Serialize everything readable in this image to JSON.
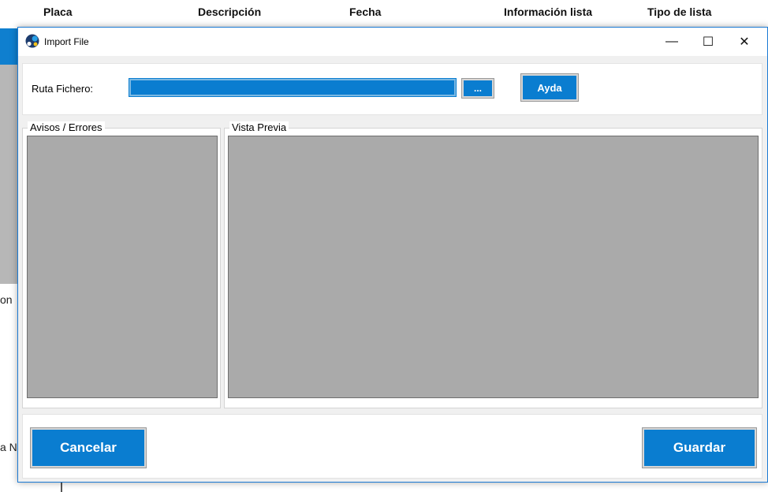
{
  "background": {
    "columns": [
      "Placa",
      "Descripción",
      "Fecha",
      "Información lista",
      "Tipo de lista"
    ],
    "fragment_1": "on",
    "fragment_2": "a N"
  },
  "dialog": {
    "title": "Import File",
    "controls": {
      "minimize": "—",
      "maximize": "☐",
      "close": "✕"
    },
    "ruta_label": "Ruta Fichero:",
    "ruta_value": "",
    "browse_label": "...",
    "help_label": "Ayda",
    "warnings_title": "Avisos / Errores",
    "preview_title": "Vista Previa",
    "cancel_label": "Cancelar",
    "save_label": "Guardar"
  },
  "colors": {
    "accent": "#0a7dd0",
    "content_gray": "#aaaaaa",
    "client_bg": "#f0f0f0"
  }
}
